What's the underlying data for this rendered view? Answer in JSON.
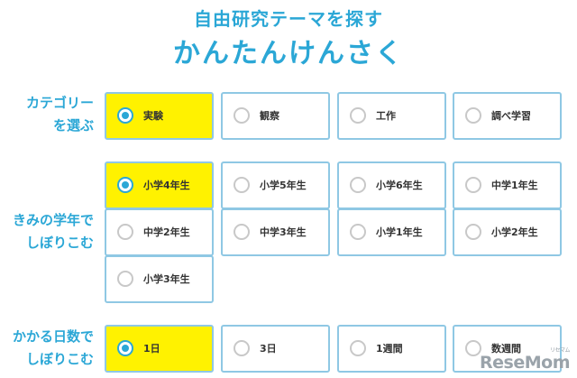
{
  "header": {
    "subtitle": "自由研究テーマを探す",
    "title": "かんたんけんさく"
  },
  "accent_color": "#2ba7d6",
  "selected_color": "#fff200",
  "sections": [
    {
      "label_line1": "カテゴリー",
      "label_line2": "を選ぶ",
      "options": [
        {
          "label": "実験",
          "selected": true
        },
        {
          "label": "観察",
          "selected": false
        },
        {
          "label": "工作",
          "selected": false
        },
        {
          "label": "調べ学習",
          "selected": false
        }
      ]
    },
    {
      "label_line1": "きみの学年で",
      "label_line2": "しぼりこむ",
      "options": [
        {
          "label": "小学4年生",
          "selected": true
        },
        {
          "label": "小学5年生",
          "selected": false
        },
        {
          "label": "小学6年生",
          "selected": false
        },
        {
          "label": "中学1年生",
          "selected": false
        },
        {
          "label": "中学2年生",
          "selected": false
        },
        {
          "label": "中学3年生",
          "selected": false
        },
        {
          "label": "小学1年生",
          "selected": false
        },
        {
          "label": "小学2年生",
          "selected": false
        },
        {
          "label": "小学3年生",
          "selected": false
        }
      ]
    },
    {
      "label_line1": "かかる日数で",
      "label_line2": "しぼりこむ",
      "options": [
        {
          "label": "1日",
          "selected": true
        },
        {
          "label": "3日",
          "selected": false
        },
        {
          "label": "1週間",
          "selected": false
        },
        {
          "label": "数週間",
          "selected": false
        }
      ]
    }
  ],
  "watermark": {
    "text": "ReseMom",
    "kana": "リセマム"
  }
}
